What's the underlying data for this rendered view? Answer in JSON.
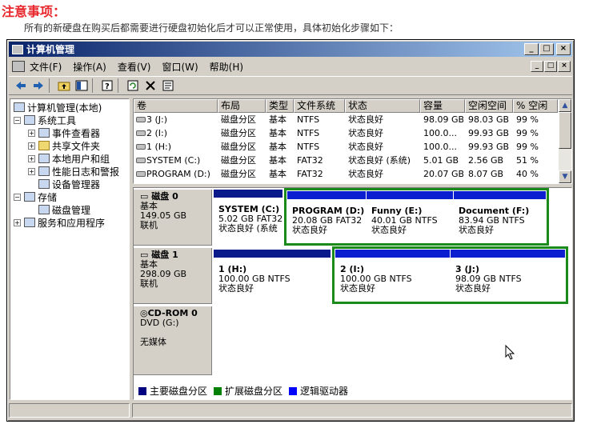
{
  "note": {
    "title": "注意事项：",
    "text": "所有的新硬盘在购买后都需要进行硬盘初始化后才可以正常使用，具体初始化步骤如下："
  },
  "window": {
    "title": "计算机管理",
    "controls": [
      "_",
      "□",
      "×"
    ]
  },
  "menu": [
    "文件(F)",
    "操作(A)",
    "查看(V)",
    "窗口(W)",
    "帮助(H)"
  ],
  "toolbar": [
    "back-arrow-icon",
    "forward-arrow-icon",
    "up-folder-icon",
    "show-hide-tree-icon",
    "help-icon",
    "refresh-icon",
    "delete-icon",
    "properties-icon"
  ],
  "tree": {
    "root": "计算机管理(本地)",
    "items": [
      {
        "label": "系统工具",
        "level": 1,
        "expander": "−"
      },
      {
        "label": "事件查看器",
        "level": 2,
        "expander": "+"
      },
      {
        "label": "共享文件夹",
        "level": 2,
        "expander": "+"
      },
      {
        "label": "本地用户和组",
        "level": 2,
        "expander": "+"
      },
      {
        "label": "性能日志和警报",
        "level": 2,
        "expander": "+"
      },
      {
        "label": "设备管理器",
        "level": 2,
        "expander": ""
      },
      {
        "label": "存储",
        "level": 1,
        "expander": "−"
      },
      {
        "label": "磁盘管理",
        "level": 2,
        "expander": ""
      },
      {
        "label": "服务和应用程序",
        "level": 1,
        "expander": "+"
      }
    ]
  },
  "volumes": {
    "columns": [
      "卷",
      "布局",
      "类型",
      "文件系统",
      "状态",
      "容量",
      "空闲空间",
      "% 空闲"
    ],
    "rows": [
      [
        "3 (J:)",
        "磁盘分区",
        "基本",
        "NTFS",
        "状态良好",
        "98.09 GB",
        "98.03 GB",
        "99 %"
      ],
      [
        "2 (I:)",
        "磁盘分区",
        "基本",
        "NTFS",
        "状态良好",
        "100.0...",
        "99.93 GB",
        "99 %"
      ],
      [
        "1 (H:)",
        "磁盘分区",
        "基本",
        "NTFS",
        "状态良好",
        "100.0...",
        "99.93 GB",
        "99 %"
      ],
      [
        "SYSTEM (C:)",
        "磁盘分区",
        "基本",
        "FAT32",
        "状态良好 (系统)",
        "5.01 GB",
        "2.56 GB",
        "51 %"
      ],
      [
        "PROGRAM (D:)",
        "磁盘分区",
        "基本",
        "FAT32",
        "状态良好",
        "20.07 GB",
        "8.07 GB",
        "40 %"
      ]
    ]
  },
  "disks": [
    {
      "name": "磁盘 0",
      "type": "基本",
      "size": "149.05 GB",
      "status": "联机",
      "partitions": [
        {
          "name": "SYSTEM  (C:)",
          "detail": "5.02 GB FAT32",
          "status": "状态良好 (系统"
        },
        {
          "name": "PROGRAM  (D:)",
          "detail": "20.08 GB FAT32",
          "status": "状态良好"
        },
        {
          "name": "Funny  (E:)",
          "detail": "40.01 GB NTFS",
          "status": "状态良好"
        },
        {
          "name": "Document  (F:)",
          "detail": "83.94 GB NTFS",
          "status": "状态良好"
        }
      ]
    },
    {
      "name": "磁盘 1",
      "type": "基本",
      "size": "298.09 GB",
      "status": "联机",
      "partitions": [
        {
          "name": "1  (H:)",
          "detail": "100.00 GB NTFS",
          "status": "状态良好"
        },
        {
          "name": "2  (I:)",
          "detail": "100.00 GB NTFS",
          "status": "状态良好"
        },
        {
          "name": "3  (J:)",
          "detail": "98.09 GB NTFS",
          "status": "状态良好"
        }
      ]
    },
    {
      "name": "CD-ROM 0",
      "type": "DVD (G:)",
      "size": "",
      "status": "无媒体",
      "partitions": []
    }
  ],
  "legend": [
    {
      "label": "主要磁盘分区",
      "color": "#000080"
    },
    {
      "label": "扩展磁盘分区",
      "color": "#008000"
    },
    {
      "label": "逻辑驱动器",
      "color": "#0000ff"
    }
  ],
  "colors": {
    "primary_bar": "#0a1a8a",
    "logical_bar": "#0b1fd0",
    "extended_border": "#1a8a1a",
    "note_title": "#e8272d"
  }
}
